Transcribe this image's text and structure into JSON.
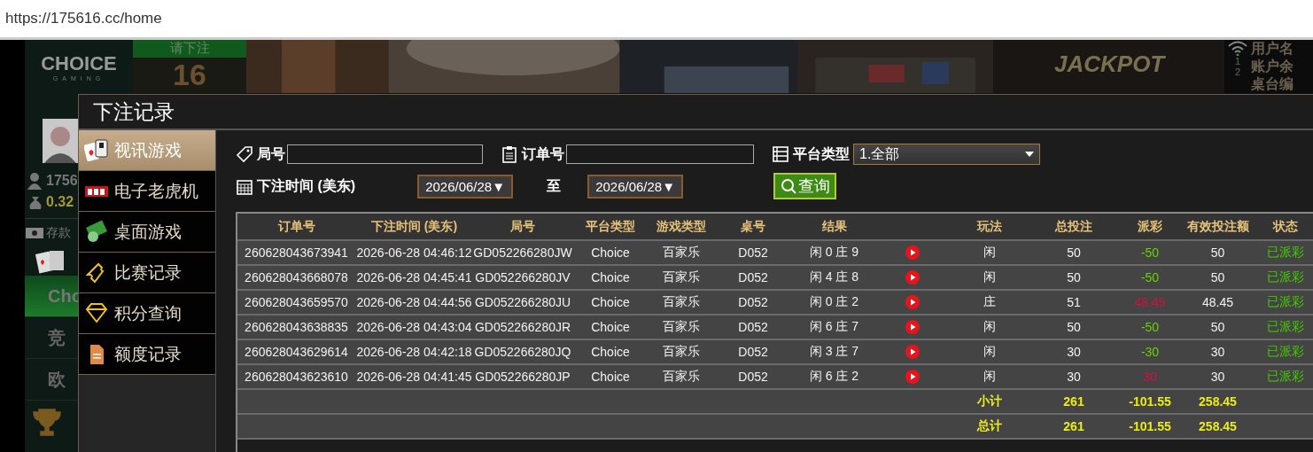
{
  "browser": {
    "url": "https://175616.cc/home"
  },
  "background": {
    "logo": "CHOICE",
    "logo_sub": "GAMING",
    "bet_prompt": "请下注",
    "countdown": "16",
    "user_id": "1756",
    "balance": "0.32",
    "deposit": "存款",
    "menu": [
      {
        "label": "Cho",
        "selected": true
      },
      {
        "label": "竞",
        "selected": false
      },
      {
        "label": "欧",
        "selected": false
      }
    ],
    "jackpot_title": "JACKPOT",
    "line_numbers": [
      "1",
      "2"
    ],
    "info_labels": [
      "用户名",
      "账户余",
      "桌台编"
    ]
  },
  "dialog": {
    "title": "下注记录",
    "sidebar": [
      {
        "label": "视讯游戏",
        "kind": "cards",
        "selected": true
      },
      {
        "label": "电子老虎机",
        "kind": "slot",
        "selected": false
      },
      {
        "label": "桌面游戏",
        "kind": "cash",
        "selected": false
      },
      {
        "label": "比赛记录",
        "kind": "ticket",
        "selected": false
      },
      {
        "label": "积分查询",
        "kind": "diamond",
        "selected": false
      },
      {
        "label": "额度记录",
        "kind": "document",
        "selected": false
      }
    ],
    "filters": {
      "round_label": "局号",
      "order_label": "订单号",
      "platform_label": "平台类型",
      "platform_value": "1.全部",
      "time_label": "下注时间 (美东)",
      "date_from": "2026/06/28▼",
      "date_sep": "至",
      "date_to": "2026/06/28▼",
      "query": "查询"
    },
    "table": {
      "columns": [
        "订单号",
        "下注时间 (美东)",
        "局号",
        "平台类型",
        "游戏类型",
        "桌号",
        "结果",
        "",
        "玩法",
        "总投注",
        "派彩",
        "有效投注额",
        "状态"
      ],
      "rows": [
        {
          "cells": [
            "260628043673941",
            "2026-06-28 04:46:12",
            "GD052266280JW",
            "Choice",
            "百家乐",
            "D052",
            "闲 0 庄 9",
            {
              "kind": "play"
            },
            "闲",
            "50",
            {
              "text": "-50",
              "color": "#66d400"
            },
            "50",
            "已派彩"
          ]
        },
        {
          "cells": [
            "260628043668078",
            "2026-06-28 04:45:41",
            "GD052266280JV",
            "Choice",
            "百家乐",
            "D052",
            "闲 4 庄 8",
            {
              "kind": "play"
            },
            "闲",
            "50",
            {
              "text": "-50",
              "color": "#66d400"
            },
            "50",
            "已派彩"
          ]
        },
        {
          "cells": [
            "260628043659570",
            "2026-06-28 04:44:56",
            "GD052266280JU",
            "Choice",
            "百家乐",
            "D052",
            "闲 0 庄 2",
            {
              "kind": "play"
            },
            "庄",
            "51",
            {
              "text": "48.45",
              "color": "#d4103c"
            },
            "48.45",
            "已派彩"
          ]
        },
        {
          "cells": [
            "260628043638835",
            "2026-06-28 04:43:04",
            "GD052266280JR",
            "Choice",
            "百家乐",
            "D052",
            "闲 6 庄 7",
            {
              "kind": "play"
            },
            "闲",
            "50",
            {
              "text": "-50",
              "color": "#66d400"
            },
            "50",
            "已派彩"
          ]
        },
        {
          "cells": [
            "260628043629614",
            "2026-06-28 04:42:18",
            "GD052266280JQ",
            "Choice",
            "百家乐",
            "D052",
            "闲 3 庄 7",
            {
              "kind": "play"
            },
            "闲",
            "30",
            {
              "text": "-30",
              "color": "#66d400"
            },
            "30",
            "已派彩"
          ]
        },
        {
          "cells": [
            "260628043623610",
            "2026-06-28 04:41:45",
            "GD052266280JP",
            "Choice",
            "百家乐",
            "D052",
            "闲 6 庄 2",
            {
              "kind": "play"
            },
            "闲",
            "30",
            {
              "text": "30",
              "color": "#d4103c"
            },
            "30",
            "已派彩"
          ]
        }
      ],
      "summary": [
        {
          "cells": [
            "",
            "",
            "",
            "",
            "",
            "",
            "",
            "",
            "小计",
            "261",
            "-101.55",
            "258.45"
          ]
        },
        {
          "cells": [
            "",
            "",
            "",
            "",
            "",
            "",
            "",
            "",
            "总计",
            "261",
            "-101.55",
            "258.45"
          ]
        }
      ]
    }
  }
}
